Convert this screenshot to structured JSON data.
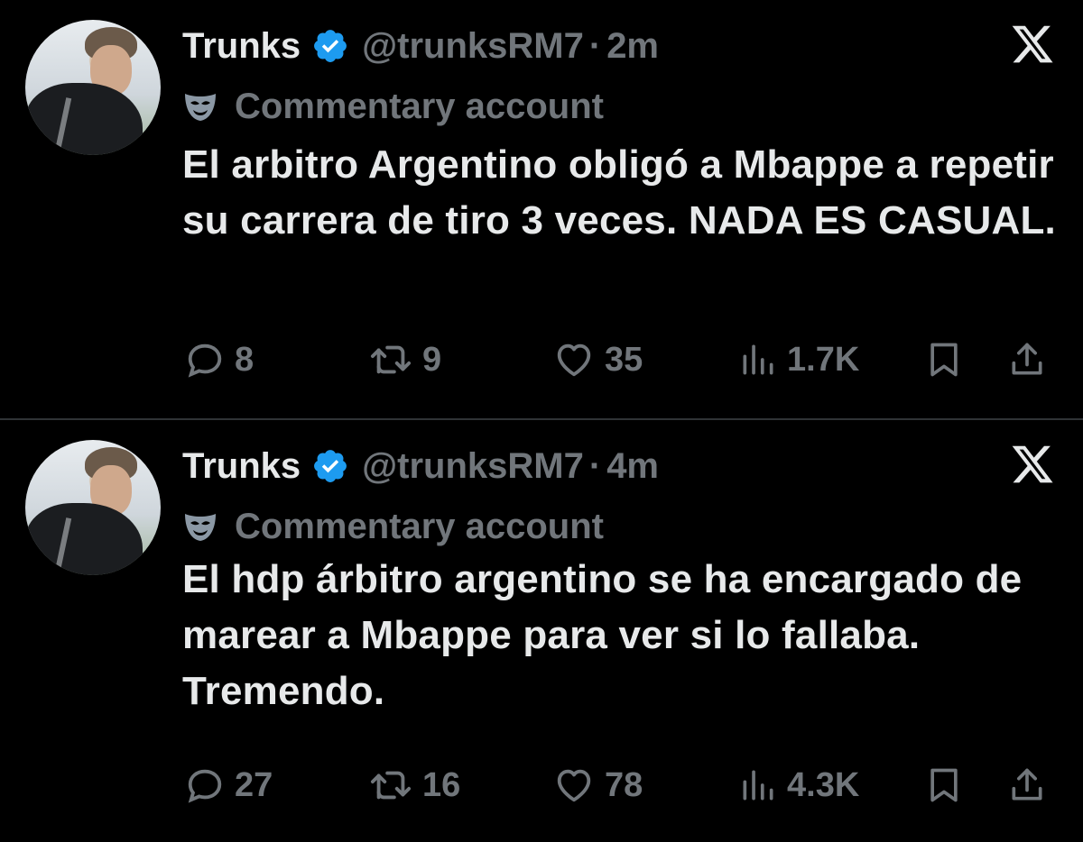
{
  "colors": {
    "background": "#000000",
    "text": "#e7e9ea",
    "muted": "#71767b",
    "verified": "#1d9bf0",
    "separator": "#2f3336"
  },
  "tweets": [
    {
      "display_name": "Trunks",
      "handle": "@trunksRM7",
      "dot": "·",
      "time": "2m",
      "account_label": "Commentary account",
      "text": "El arbitro Argentino obligó a Mbappe a repetir su carrera de tiro 3 veces. NADA ES CASUAL.",
      "replies": "8",
      "reposts": "9",
      "likes": "35",
      "views": "1.7K",
      "icons": [
        "avatar",
        "verified-badge-icon",
        "x-logo-icon",
        "commentary-mask-icon",
        "reply-icon",
        "repost-icon",
        "like-icon",
        "views-icon",
        "bookmark-icon",
        "share-icon"
      ]
    },
    {
      "display_name": "Trunks",
      "handle": "@trunksRM7",
      "dot": "·",
      "time": "4m",
      "account_label": "Commentary account",
      "text": "El hdp árbitro argentino se ha encargado de marear a Mbappe para ver si lo fallaba. Tremendo.",
      "replies": "27",
      "reposts": "16",
      "likes": "78",
      "views": "4.3K",
      "icons": [
        "avatar",
        "verified-badge-icon",
        "x-logo-icon",
        "commentary-mask-icon",
        "reply-icon",
        "repost-icon",
        "like-icon",
        "views-icon",
        "bookmark-icon",
        "share-icon"
      ]
    }
  ]
}
